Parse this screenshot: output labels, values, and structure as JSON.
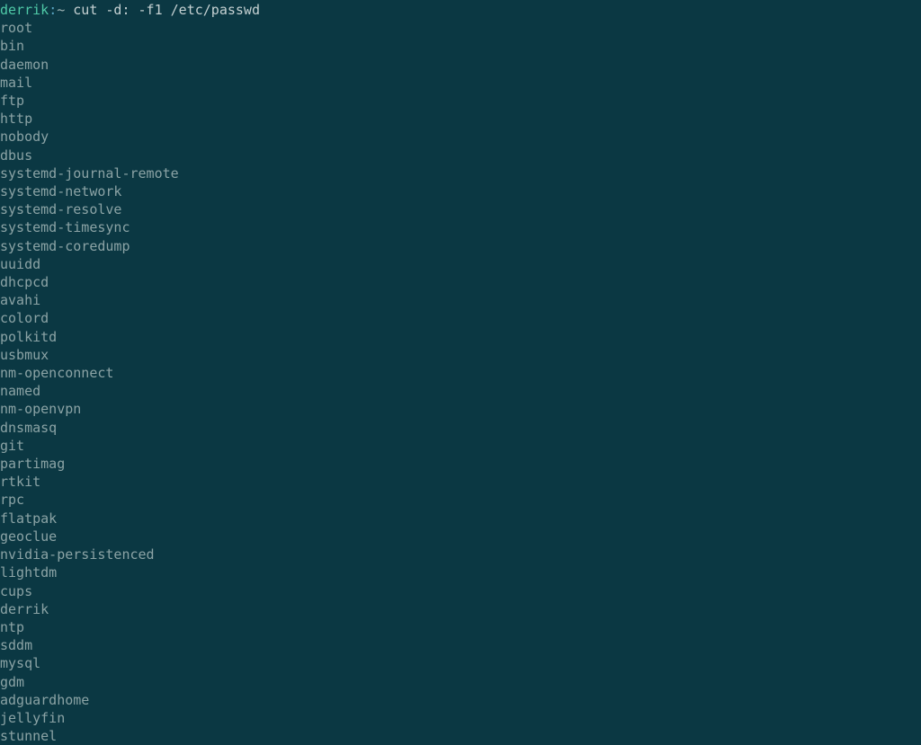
{
  "prompt": {
    "user": "derrik",
    "sep": ":",
    "path": "~",
    "command": "cut -d: -f1 /etc/passwd"
  },
  "output": [
    "root",
    "bin",
    "daemon",
    "mail",
    "ftp",
    "http",
    "nobody",
    "dbus",
    "systemd-journal-remote",
    "systemd-network",
    "systemd-resolve",
    "systemd-timesync",
    "systemd-coredump",
    "uuidd",
    "dhcpcd",
    "avahi",
    "colord",
    "polkitd",
    "usbmux",
    "nm-openconnect",
    "named",
    "nm-openvpn",
    "dnsmasq",
    "git",
    "partimag",
    "rtkit",
    "rpc",
    "flatpak",
    "geoclue",
    "nvidia-persistenced",
    "lightdm",
    "cups",
    "derrik",
    "ntp",
    "sddm",
    "mysql",
    "gdm",
    "adguardhome",
    "jellyfin",
    "stunnel"
  ]
}
